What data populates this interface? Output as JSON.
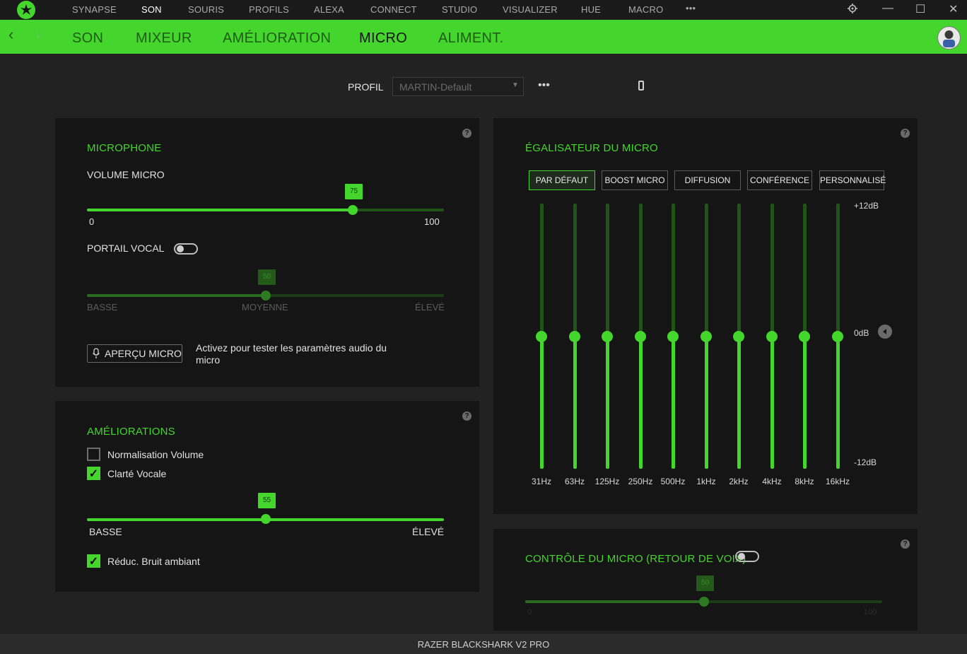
{
  "titlebar": {
    "nav": [
      "SYNAPSE",
      "SON",
      "SOURIS",
      "PROFILS",
      "ALEXA",
      "CONNECT",
      "STUDIO",
      "VISUALIZER",
      "HUE",
      "MACRO"
    ],
    "more": "•••",
    "settings_icon": "gear-icon",
    "minimize": "—",
    "maximize": "☐",
    "close": "✕"
  },
  "subnav": {
    "back": "‹",
    "forward": "›",
    "tabs": [
      "SON",
      "MIXEUR",
      "AMÉLIORATION",
      "MICRO",
      "ALIMENT."
    ],
    "active_tab": "MICRO"
  },
  "profile": {
    "label": "PROFIL",
    "value": "MARTIN-Default",
    "more": "•••"
  },
  "microphone": {
    "title": "MICROPHONE",
    "volume_label": "VOLUME MICRO",
    "volume_value": "75",
    "volume_min": "0",
    "volume_max": "100",
    "portail_label": "PORTAIL VOCAL",
    "portail_on": false,
    "gate_value": "50",
    "gate_low": "BASSE",
    "gate_mid": "MOYENNE",
    "gate_high": "ÉLEVÉ",
    "apercu_button": "APERÇU MICRO",
    "apercu_text_1": "Activez pour tester les paramètres audio du",
    "apercu_text_2": "micro"
  },
  "ameliorations": {
    "title": "AMÉLIORATIONS",
    "normalisation_label": "Normalisation Volume",
    "normalisation_checked": false,
    "clarte_label": "Clarté Vocale",
    "clarte_checked": true,
    "clarte_value": "55",
    "clarte_low": "BASSE",
    "clarte_high": "ÉLEVÉ",
    "reduc_label": "Réduc. Bruit ambiant",
    "reduc_checked": true
  },
  "eq": {
    "title": "ÉGALISATEUR DU MICRO",
    "presets": [
      "PAR DÉFAUT",
      "BOOST MICRO",
      "DIFFUSION",
      "CONFÉRENCE",
      "PERSONNALISÉ"
    ],
    "selected_preset": "PAR DÉFAUT",
    "bands": [
      "31Hz",
      "63Hz",
      "125Hz",
      "250Hz",
      "500Hz",
      "1kHz",
      "2kHz",
      "4kHz",
      "8kHz",
      "16kHz"
    ],
    "band_gains_db": [
      0,
      0,
      0,
      0,
      0,
      0,
      0,
      0,
      0,
      0
    ],
    "db_max": "+12dB",
    "db_zero": "0dB",
    "db_min": "-12dB"
  },
  "controle": {
    "title": "CONTRÔLE DU MICRO (RETOUR DE VOIX)",
    "toggle_on": false,
    "value": "50",
    "min": "0",
    "max": "100"
  },
  "footer": {
    "device": "RAZER BLACKSHARK V2 PRO"
  },
  "colors": {
    "accent": "#44d62c",
    "bg": "#222222",
    "panel": "#151515"
  }
}
